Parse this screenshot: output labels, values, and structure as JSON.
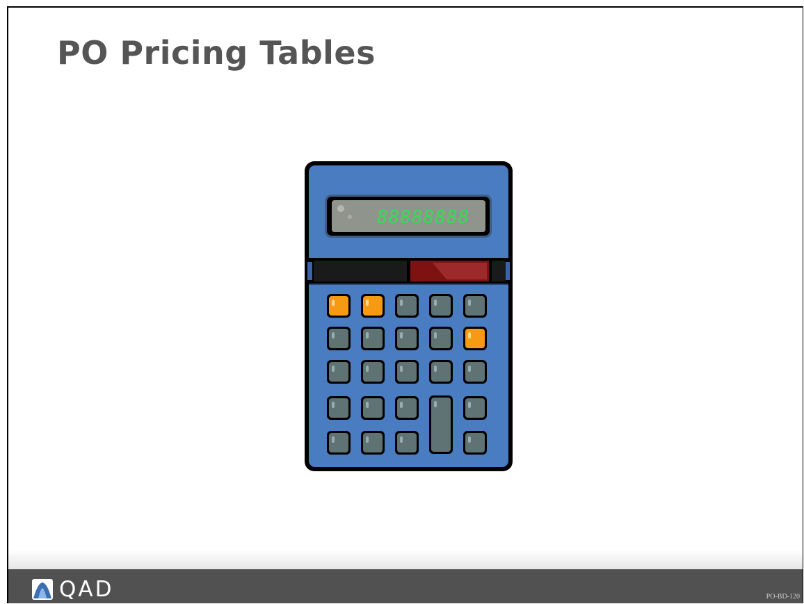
{
  "slide": {
    "title": "PO Pricing Tables"
  },
  "calculator": {
    "display_text": "88888888"
  },
  "footer": {
    "logo_text": "QAD",
    "slide_code": "PO-BD-120"
  }
}
